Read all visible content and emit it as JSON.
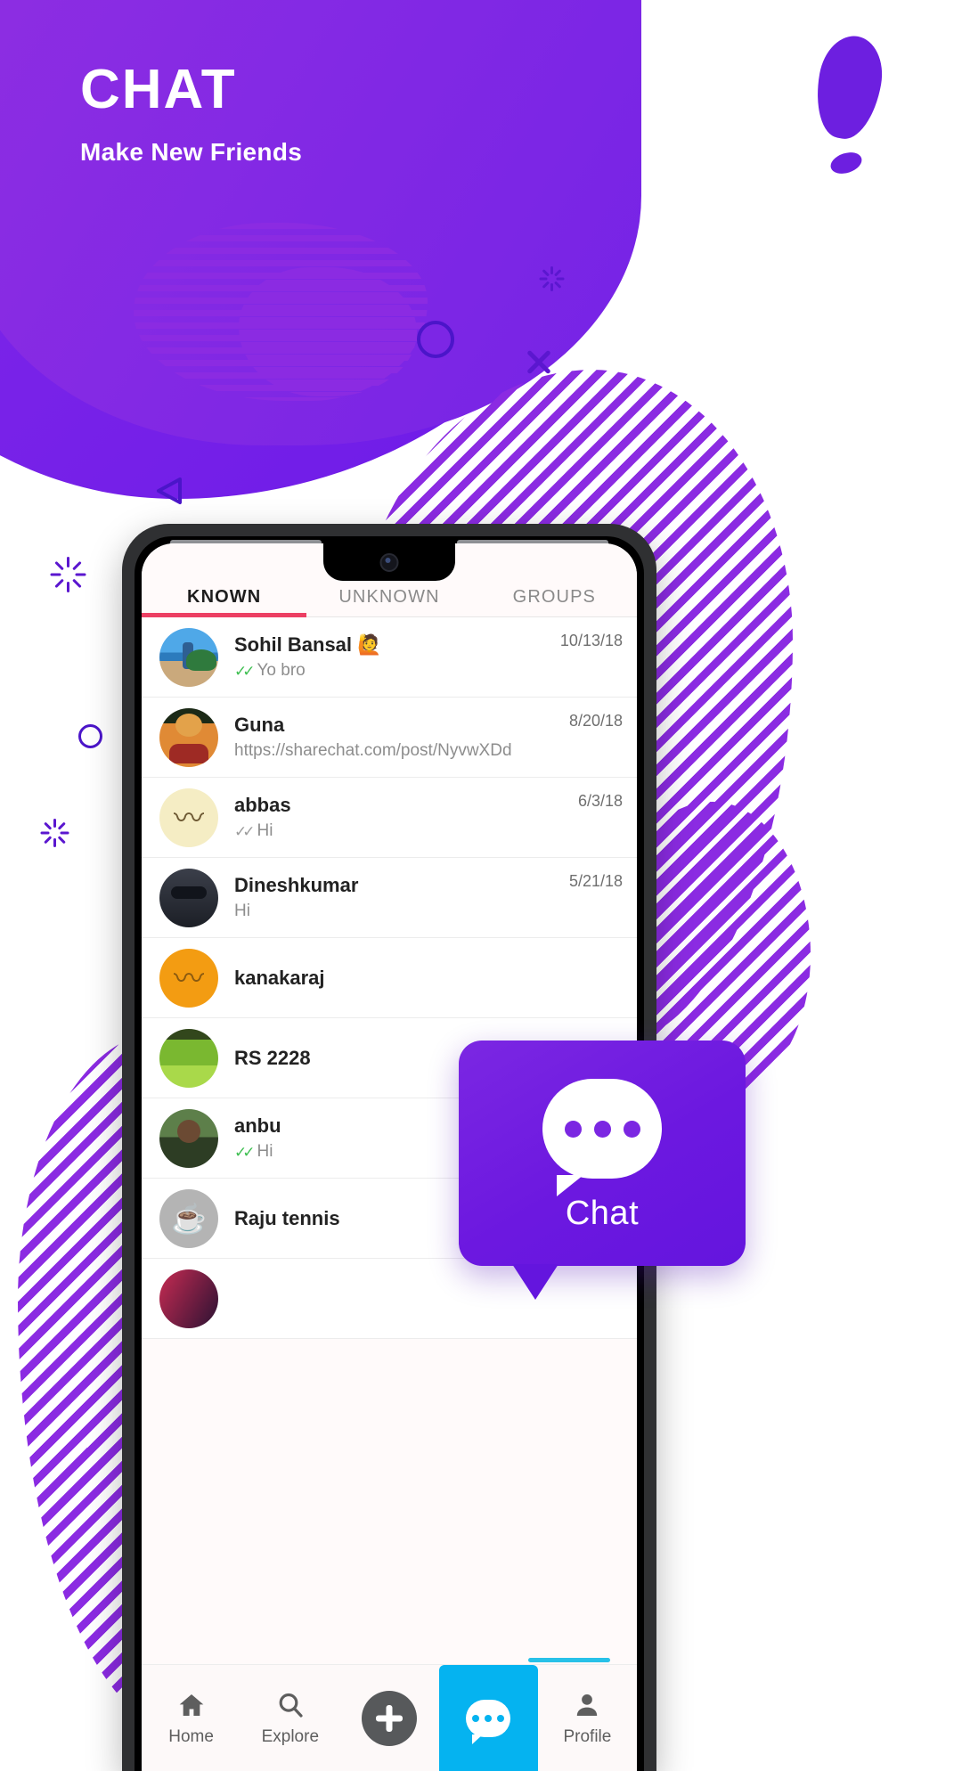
{
  "hero": {
    "title": "CHAT",
    "subtitle": "Make New Friends"
  },
  "callout": {
    "label": "Chat",
    "icon": "chat-bubble-icon"
  },
  "phone": {
    "tabs": [
      {
        "label": "KNOWN",
        "active": true
      },
      {
        "label": "UNKNOWN",
        "active": false
      },
      {
        "label": "GROUPS",
        "active": false
      }
    ],
    "chats": [
      {
        "name": "Sohil Bansal 🙋",
        "message": "Yo bro",
        "date": "10/13/18",
        "ticks": "read",
        "avatar": "beach-photo-avatar"
      },
      {
        "name": "Guna",
        "message": "https://sharechat.com/post/NyvwXDd",
        "date": "8/20/18",
        "ticks": "none",
        "avatar": "hanuman-photo-avatar"
      },
      {
        "name": "abbas",
        "message": "Hi",
        "date": "6/3/18",
        "ticks": "sent",
        "avatar": "mustache-cream-avatar"
      },
      {
        "name": "Dineshkumar",
        "message": "Hi",
        "date": "5/21/18",
        "ticks": "none",
        "avatar": "sunglasses-photo-avatar"
      },
      {
        "name": "kanakaraj",
        "message": "",
        "date": "",
        "ticks": "none",
        "avatar": "mustache-orange-avatar"
      },
      {
        "name": "RS 2228",
        "message": "",
        "date": "",
        "ticks": "none",
        "avatar": "grass-photo-avatar"
      },
      {
        "name": "anbu",
        "message": "Hi",
        "date": "",
        "ticks": "read",
        "avatar": "man-photo-avatar"
      },
      {
        "name": "Raju tennis",
        "message": "",
        "date": "",
        "ticks": "none",
        "avatar": "cup-gray-avatar"
      }
    ],
    "bottom_nav": [
      {
        "label": "Home",
        "icon": "home-icon",
        "active": false
      },
      {
        "label": "Explore",
        "icon": "search-icon",
        "active": false
      },
      {
        "label": "",
        "icon": "plus-icon",
        "active": false
      },
      {
        "label": "",
        "icon": "chat-icon",
        "active": true
      },
      {
        "label": "Profile",
        "icon": "person-icon",
        "active": false
      }
    ]
  },
  "colors": {
    "brand_purple": "#7b27e2",
    "deep_purple": "#6415de",
    "accent_pink": "#ec3f63",
    "accent_cyan": "#05b3f0",
    "tick_read_green": "#3fbf52",
    "teal_bar": "#28c1e8"
  }
}
